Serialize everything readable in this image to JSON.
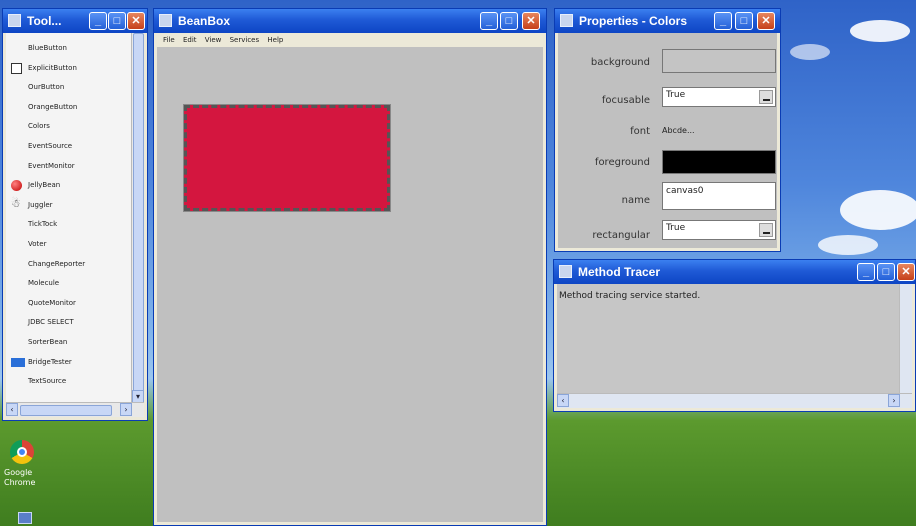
{
  "desktop": {
    "icon_label_line1": "Google",
    "icon_label_line2": "Chrome"
  },
  "toolbox": {
    "title": "Tool...",
    "items": [
      {
        "label": "BlueButton"
      },
      {
        "label": "ExplicitButton"
      },
      {
        "label": "OurButton"
      },
      {
        "label": "OrangeButton"
      },
      {
        "label": "Colors"
      },
      {
        "label": "EventSource"
      },
      {
        "label": "EventMonitor"
      },
      {
        "label": "JellyBean"
      },
      {
        "label": "Juggler"
      },
      {
        "label": "TickTock"
      },
      {
        "label": "Voter"
      },
      {
        "label": "ChangeReporter"
      },
      {
        "label": "Molecule"
      },
      {
        "label": "QuoteMonitor"
      },
      {
        "label": "JDBC SELECT"
      },
      {
        "label": "SorterBean"
      },
      {
        "label": "BridgeTester"
      },
      {
        "label": "TextSource"
      }
    ]
  },
  "beanbox": {
    "title": "BeanBox",
    "menu": [
      "File",
      "Edit",
      "View",
      "Services",
      "Help"
    ],
    "bean_color": "#d4163f"
  },
  "properties": {
    "title": "Properties - Colors",
    "rows": {
      "background": {
        "label": "background"
      },
      "focusable": {
        "label": "focusable",
        "value": "True"
      },
      "font": {
        "label": "font",
        "value": "Abcde..."
      },
      "foreground": {
        "label": "foreground"
      },
      "name": {
        "label": "name",
        "value": "canvas0"
      },
      "rectangular": {
        "label": "rectangular",
        "value": "True"
      }
    }
  },
  "tracer": {
    "title": "Method Tracer",
    "text": "Method tracing service started."
  },
  "window_controls": {
    "minimize": "_",
    "maximize": "□",
    "close": "✕"
  }
}
